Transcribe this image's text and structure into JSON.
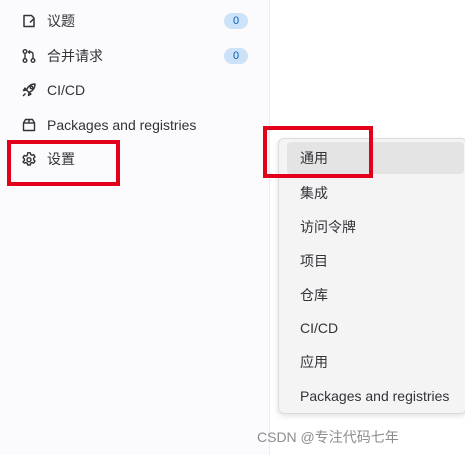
{
  "sidebar": {
    "items": [
      {
        "label": "议题",
        "icon": "issues-icon",
        "badge": "0"
      },
      {
        "label": "合并请求",
        "icon": "merge-request-icon",
        "badge": "0"
      },
      {
        "label": "CI/CD",
        "icon": "rocket-icon"
      },
      {
        "label": "Packages and registries",
        "icon": "package-icon"
      },
      {
        "label": "设置",
        "icon": "gear-icon"
      }
    ]
  },
  "flyout": {
    "items": [
      {
        "label": "通用",
        "active": true
      },
      {
        "label": "集成"
      },
      {
        "label": "访问令牌"
      },
      {
        "label": "项目"
      },
      {
        "label": "仓库"
      },
      {
        "label": "CI/CD"
      },
      {
        "label": "应用"
      },
      {
        "label": "Packages and registries"
      }
    ]
  },
  "watermark": "CSDN @专注代码七年",
  "colors": {
    "highlight": "#e3001b",
    "badge_bg": "#cbe2f9",
    "badge_text": "#0b5cad",
    "sidebar_bg": "#fbfafd",
    "flyout_bg": "#f4f4f4"
  }
}
